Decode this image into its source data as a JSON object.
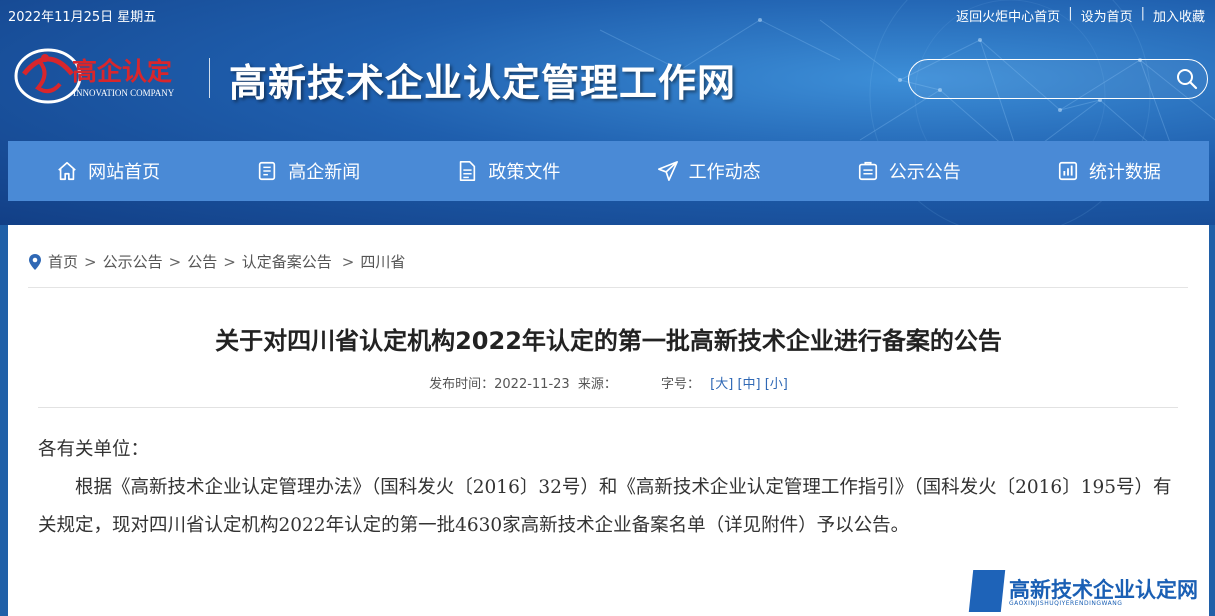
{
  "topbar": {
    "date": "2022年11月25日 星期五",
    "links": [
      "返回火炬中心首页",
      "设为首页",
      "加入收藏"
    ]
  },
  "logo": {
    "name_cn": "高企认定",
    "name_en": "INNOVATION COMPANY"
  },
  "site_title": "高新技术企业认定管理工作网",
  "search": {
    "placeholder": ""
  },
  "nav": [
    {
      "label": "网站首页",
      "icon": "home-icon"
    },
    {
      "label": "高企新闻",
      "icon": "news-icon"
    },
    {
      "label": "政策文件",
      "icon": "document-icon"
    },
    {
      "label": "工作动态",
      "icon": "paper-plane-icon"
    },
    {
      "label": "公示公告",
      "icon": "notice-board-icon"
    },
    {
      "label": "统计数据",
      "icon": "chart-icon"
    }
  ],
  "breadcrumb": [
    "首页",
    "公示公告",
    "公告",
    "认定备案公告",
    "四川省"
  ],
  "article": {
    "title": "关于对四川省认定机构2022年认定的第一批高新技术企业进行备案的公告",
    "meta_publish_label": "发布时间：",
    "publish_date": "2022-11-23",
    "source_label": "来源：",
    "font_size_label": "字号：",
    "font_sizes": [
      "[大]",
      "[中]",
      "[小]"
    ],
    "salutation": "各有关单位：",
    "paragraph": "根据《高新技术企业认定管理办法》（国科发火〔2016〕32号）和《高新技术企业认定管理工作指引》（国科发火〔2016〕195号）有关规定，现对四川省认定机构2022年认定的第一批4630家高新技术企业备案名单（详见附件）予以公告。"
  },
  "watermark": {
    "text": "高新技术企业认定网",
    "sub": "GAOXINJISHUQIYERENDINGWANG"
  },
  "colors": {
    "header_bg": "#1f5fae",
    "nav_bg": "#4a8ad6",
    "link": "#2f68b5",
    "logo_red": "#d8262c"
  }
}
